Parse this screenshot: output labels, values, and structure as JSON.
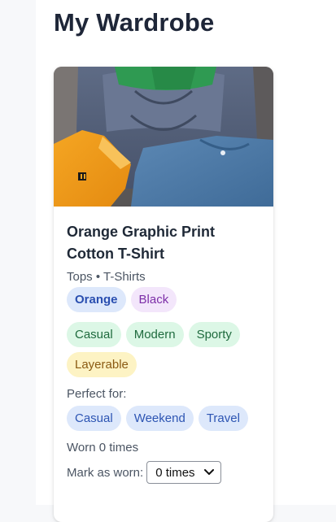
{
  "page": {
    "title": "My Wardrobe"
  },
  "item": {
    "name_line1": "Orange Graphic Print",
    "name_line2": "Cotton T-Shirt",
    "category": "Tops • T-Shirts",
    "colors": [
      "Orange",
      "Black"
    ],
    "styles": [
      "Casual",
      "Modern",
      "Sporty",
      "Layerable"
    ],
    "perfect_for_label": "Perfect for:",
    "occasions": [
      "Casual",
      "Weekend",
      "Travel"
    ],
    "worn_count": "Worn 0 times",
    "mark_as_worn_label": "Mark as worn:",
    "mark_as_worn_value": "0 times"
  },
  "colors": {
    "title": "#1e2638",
    "color_chip_primary": "#dde8fb",
    "color_chip_secondary": "#f3e6fb",
    "style_chip": "#dcf7e6",
    "layer_chip": "#fdf3c4"
  }
}
